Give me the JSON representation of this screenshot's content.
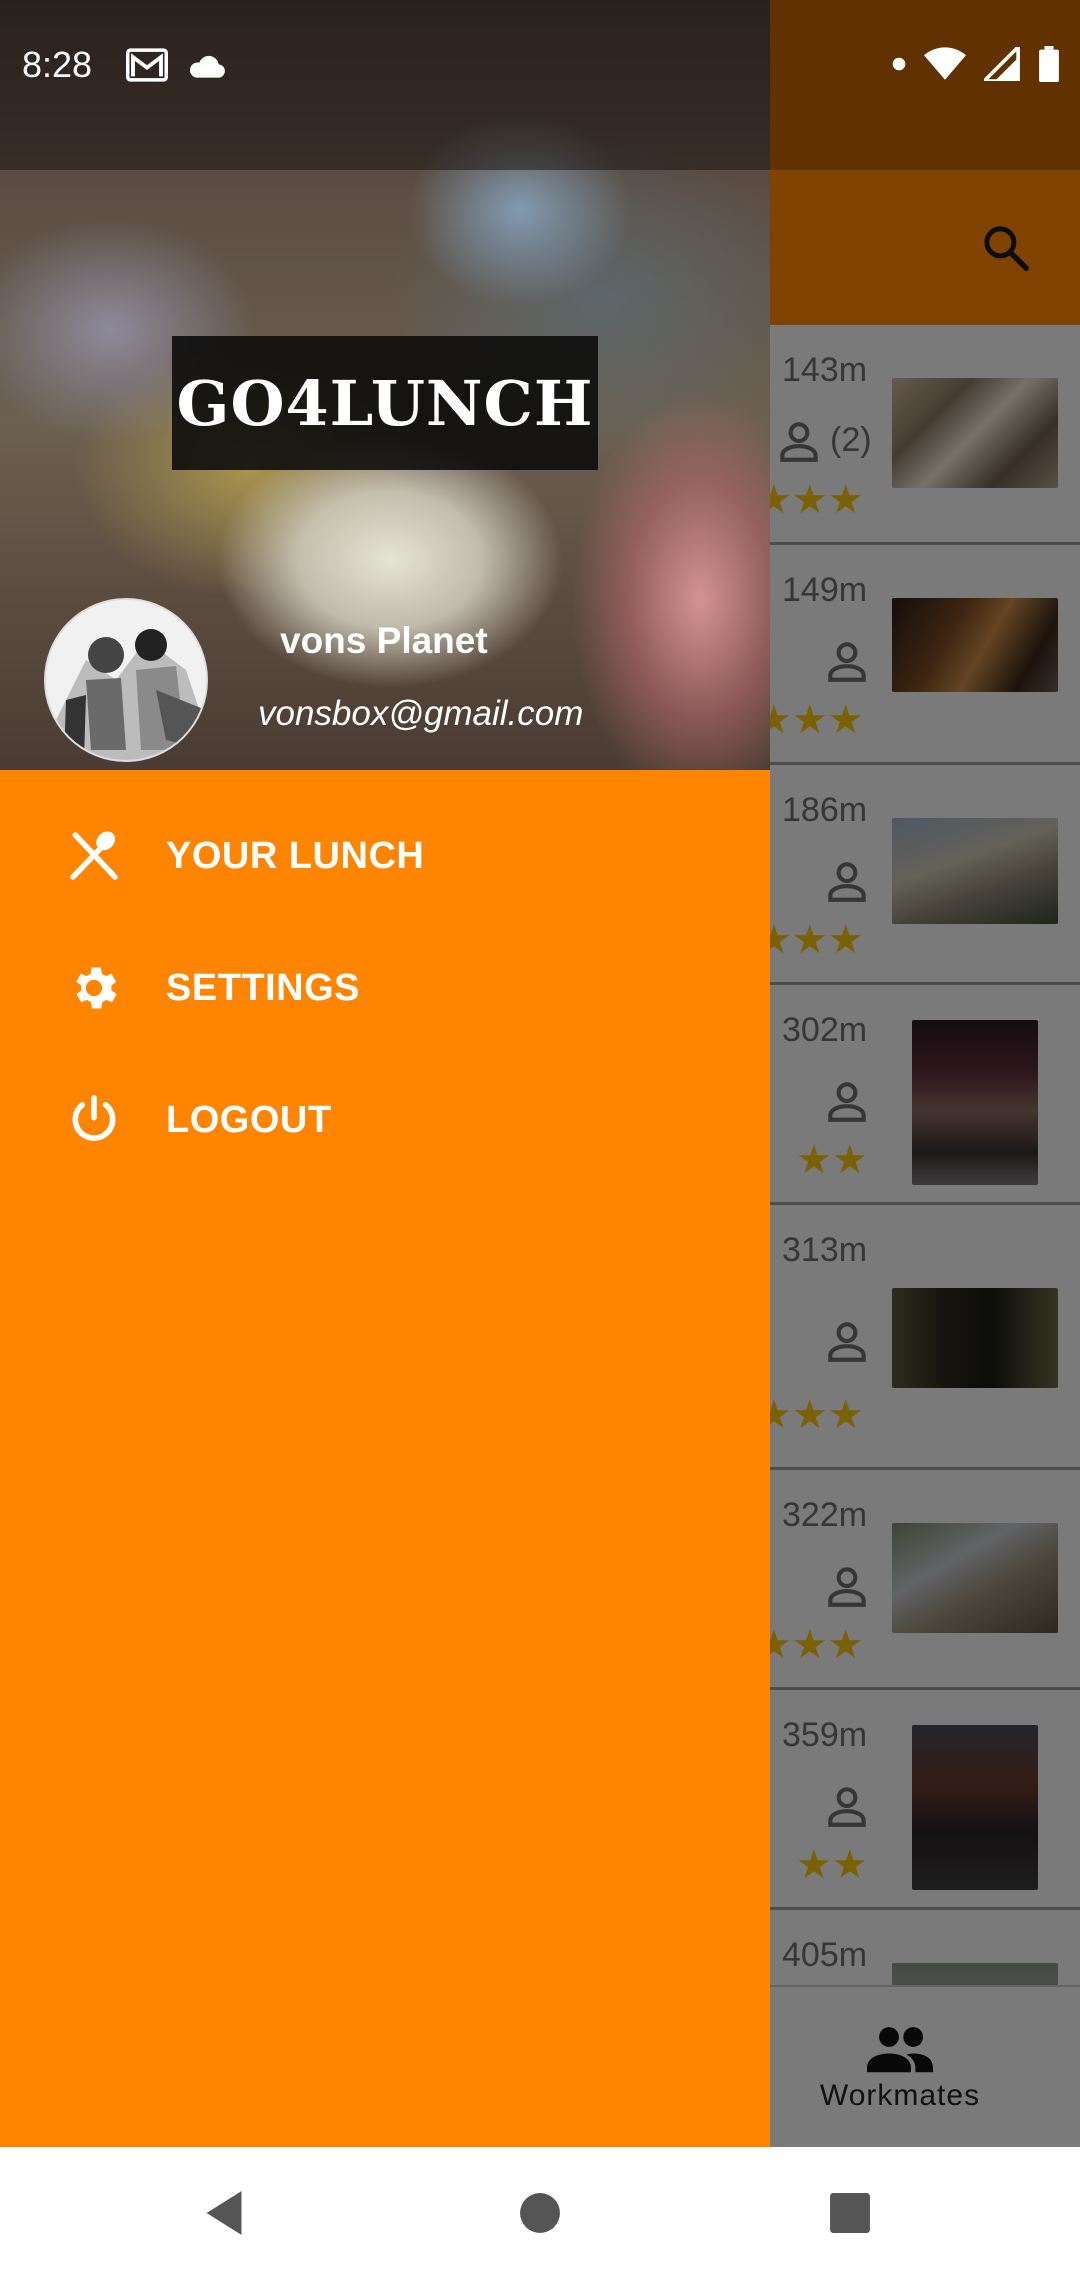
{
  "statusbar": {
    "time": "8:28",
    "left_icons": [
      "gmail-icon",
      "cloud-icon"
    ],
    "right_icons": [
      "dot-icon",
      "wifi-icon",
      "signal-icon",
      "battery-icon"
    ]
  },
  "drawer": {
    "app_logo": "GO4LUNCH",
    "user": {
      "name": "vons Planet",
      "email": "vonsbox@gmail.com"
    },
    "menu": [
      {
        "label": "YOUR LUNCH",
        "icon": "fork-knife-icon"
      },
      {
        "label": "SETTINGS",
        "icon": "gear-icon"
      },
      {
        "label": "LOGOUT",
        "icon": "power-icon"
      }
    ],
    "background_color": "#ff8500"
  },
  "app": {
    "toolbar_color": "#ff8500",
    "restaurants": [
      {
        "distance": "143m",
        "workmates": "(2)",
        "rating": 3
      },
      {
        "distance": "149m",
        "workmates": "",
        "rating": 3
      },
      {
        "distance": "186m",
        "workmates": "",
        "rating": 3
      },
      {
        "distance": "302m",
        "workmates": "",
        "rating": 2
      },
      {
        "distance": "313m",
        "workmates": "",
        "rating": 3
      },
      {
        "distance": "322m",
        "workmates": "",
        "rating": 3
      },
      {
        "distance": "359m",
        "workmates": "",
        "rating": 2
      },
      {
        "distance": "405m",
        "workmates": "",
        "rating": 0
      }
    ],
    "bottom_nav": {
      "workmates_label": "Workmates"
    }
  },
  "sysnav": {
    "buttons": [
      "back-icon",
      "home-icon",
      "recents-icon"
    ]
  }
}
